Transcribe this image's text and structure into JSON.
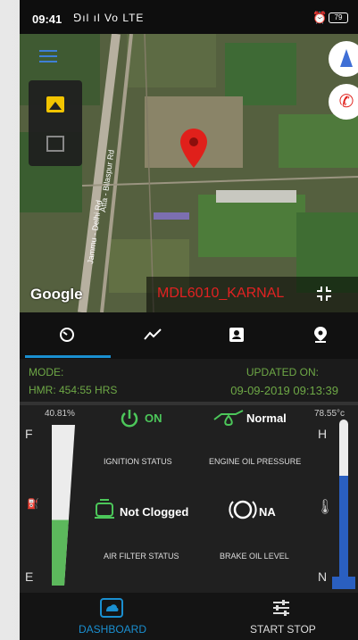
{
  "status_bar": {
    "time": "09:41",
    "signal": "⅁ıl ıl Vo LTE",
    "battery": "79",
    "icons": [
      "signal-icon",
      "alarm-icon",
      "battery-icon"
    ]
  },
  "map": {
    "attribution": "Google",
    "vehicle_id": "MDL6010_KARNAL",
    "road_labels": [
      "Jammu - Delhi Rd",
      "Atta - Bilaspur Rd"
    ],
    "icons": [
      "hamburger-menu-icon",
      "satellite-layer-icon",
      "map-layer-icon",
      "compass-icon",
      "call-icon",
      "location-pin-icon",
      "collapse-icon"
    ],
    "colors": {
      "pin": "#e0201b",
      "vehicle_text": "#e12222"
    }
  },
  "tabs": [
    {
      "icon": "speedometer-icon",
      "active": true
    },
    {
      "icon": "trend-icon",
      "active": false
    },
    {
      "icon": "contact-card-icon",
      "active": false
    },
    {
      "icon": "location-marker-icon",
      "active": false
    }
  ],
  "info": {
    "mode_label": "MODE:",
    "hmr": "HMR: 454:55 HRS",
    "updated_label": "UPDATED ON:",
    "updated_value": "09-09-2019 09:13:39",
    "color": "#6ea846"
  },
  "fuel": {
    "percent_label": "40.81%",
    "level": 0.4081,
    "full_label": "F",
    "empty_label": "E",
    "color": "#5cb85c"
  },
  "temperature": {
    "value_label": "78.55°c",
    "level": 0.65,
    "high_label": "H",
    "normal_label": "N",
    "color": "#2a5fc0"
  },
  "tiles": {
    "ignition": {
      "value": "ON",
      "label": "IGNITION STATUS",
      "color": "#4cc75a"
    },
    "engine_oil": {
      "value": "Normal",
      "label": "ENGINE OIL PRESSURE",
      "color": "#4cc75a"
    },
    "air_filter": {
      "value": "Not Clogged",
      "label": "AIR FILTER STATUS",
      "color": "#4cc75a"
    },
    "brake_oil": {
      "value": "NA",
      "label": "BRAKE OIL LEVEL",
      "color": "#ffffff"
    }
  },
  "bottom_nav": {
    "dashboard_label": "DASHBOARD",
    "startstop_label": "START STOP",
    "active_color": "#1a8fd0"
  }
}
